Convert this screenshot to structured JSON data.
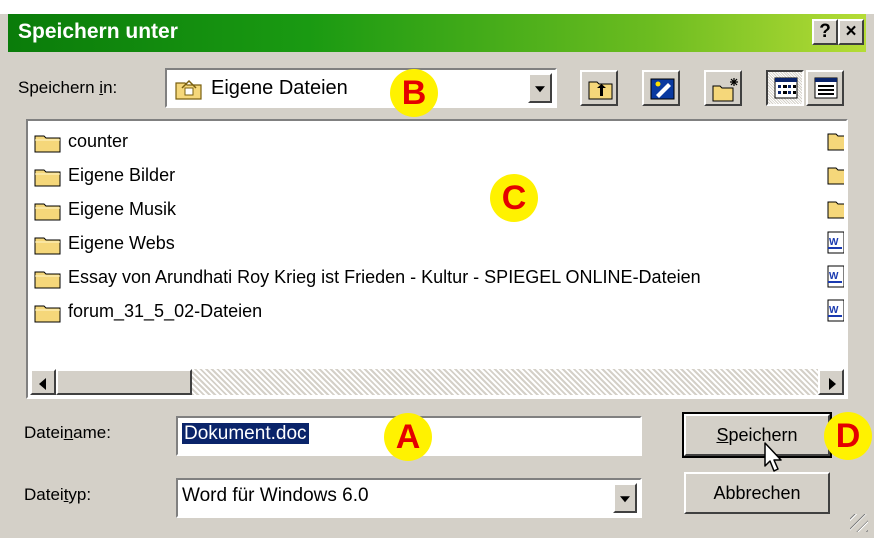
{
  "window": {
    "title": "Speichern unter",
    "help_btn": "?",
    "close_btn": "×"
  },
  "save_in": {
    "label_pre": "Speichern ",
    "label_mn": "i",
    "label_post": "n:",
    "value": "Eigene Dateien"
  },
  "toolbar": [
    "up-one-level",
    "desktop",
    "new-folder",
    "list-view",
    "details-view"
  ],
  "files": [
    {
      "name": "counter",
      "type": "folder"
    },
    {
      "name": "Eigene Bilder",
      "type": "folder"
    },
    {
      "name": "Eigene Musik",
      "type": "folder"
    },
    {
      "name": "Eigene Webs",
      "type": "folder"
    },
    {
      "name": "Essay von Arundhati Roy Krieg ist Frieden - Kultur - SPIEGEL ONLINE-Dateien",
      "type": "folder"
    },
    {
      "name": "forum_31_5_02-Dateien",
      "type": "folder"
    }
  ],
  "filename": {
    "label_pre": "Datei",
    "label_mn": "n",
    "label_post": "ame:",
    "value": "Dokument.doc"
  },
  "filetype": {
    "label_pre": "Datei",
    "label_mn": "t",
    "label_post": "yp:",
    "value": "Word für Windows 6.0"
  },
  "buttons": {
    "save_mn": "S",
    "save_rest": "peichern",
    "cancel": "Abbrechen"
  },
  "markers": {
    "a": "A",
    "b": "B",
    "c": "C",
    "d": "D"
  },
  "colors": {
    "title_start": "#0a7c0a",
    "title_end": "#b5dc36",
    "selection": "#0a246a",
    "marker_bg": "#fff200",
    "marker_fg": "#e40000"
  }
}
